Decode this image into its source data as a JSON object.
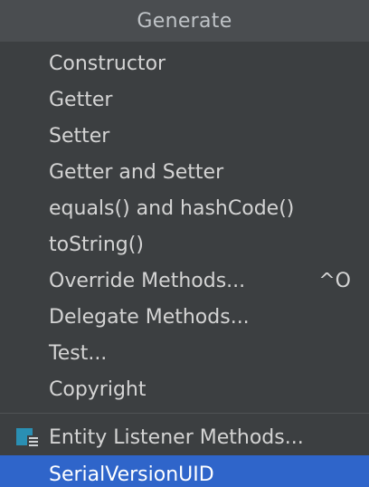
{
  "popup": {
    "title": "Generate",
    "items": [
      {
        "label": "Constructor"
      },
      {
        "label": "Getter"
      },
      {
        "label": "Setter"
      },
      {
        "label": "Getter and Setter"
      },
      {
        "label": "equals() and hashCode()"
      },
      {
        "label": "toString()"
      },
      {
        "label": "Override Methods...",
        "shortcut": "^O"
      },
      {
        "label": "Delegate Methods..."
      },
      {
        "label": "Test..."
      },
      {
        "label": "Copyright"
      }
    ],
    "extra_items": [
      {
        "label": "Entity Listener Methods...",
        "icon": "entity-listener-icon"
      },
      {
        "label": "SerialVersionUID",
        "selected": true
      }
    ]
  },
  "colors": {
    "background": "#3c3f41",
    "header": "#4a4d50",
    "selection": "#2f65ca",
    "icon_teal": "#2a8fb3"
  }
}
